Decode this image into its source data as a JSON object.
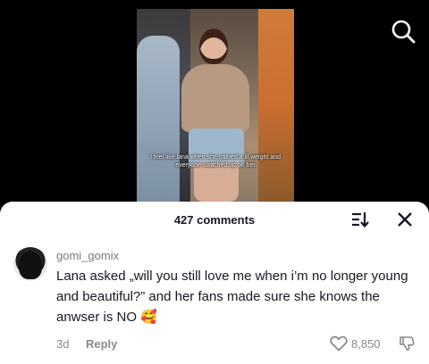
{
  "video": {
    "caption": "I feel like lana when she gained a lil weight and everyone switched up on her"
  },
  "header": {
    "comment_count_label": "427 comments"
  },
  "icons": {
    "search": "search-icon",
    "sort": "sort-icon",
    "close": "close-icon",
    "heart": "heart-icon",
    "dislike": "thumbs-down-icon"
  },
  "comment": {
    "username": "gomi_gomix",
    "text": "Lana asked „will you still love me when i’m no longer young and beautiful?” and her fans made sure she knows the anwser is NO",
    "emoji": "🥰",
    "age": "3d",
    "reply_label": "Reply",
    "like_count": "8,850"
  },
  "colors": {
    "background": "#000000",
    "sheet": "#ffffff",
    "primary_text": "#161823",
    "secondary_text": "#8a8a8a"
  }
}
